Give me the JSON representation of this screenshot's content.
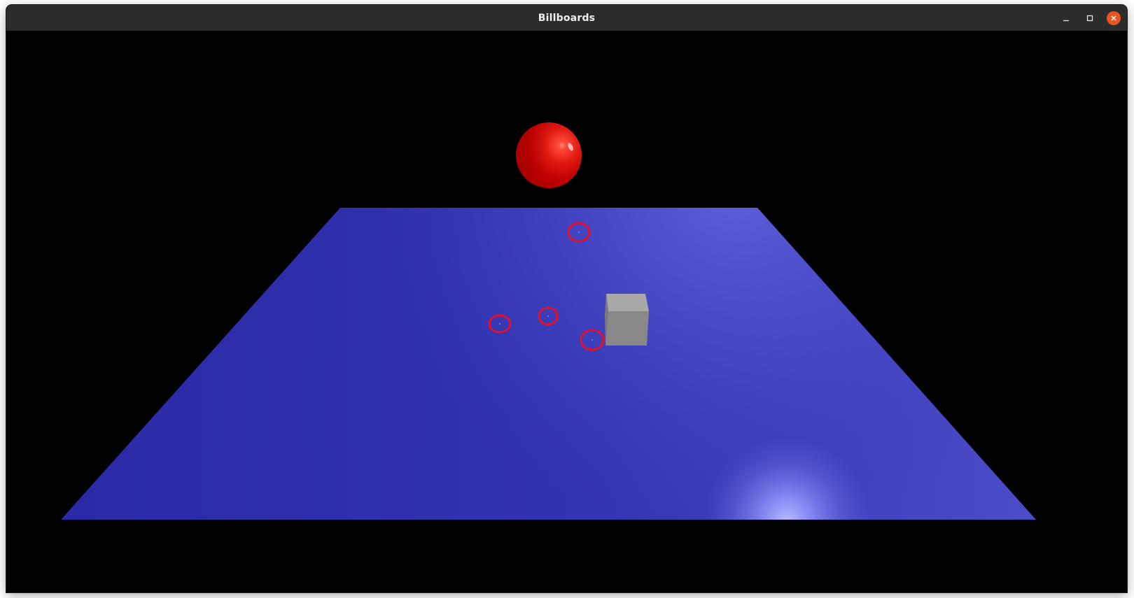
{
  "window": {
    "title": "Billboards",
    "controls": {
      "minimize_icon": "minimize-icon",
      "maximize_icon": "maximize-icon",
      "close_icon": "close-icon",
      "close_color": "#e95420"
    }
  },
  "scene": {
    "background_color": "#000000",
    "floor_color": "#2e2fab",
    "floor_highlight_color": "#5f61dc",
    "sphere_color": "#d40000",
    "cube_color": "#8c8c8c",
    "billboard_color": "#e0102a",
    "billboard_count": 4
  }
}
